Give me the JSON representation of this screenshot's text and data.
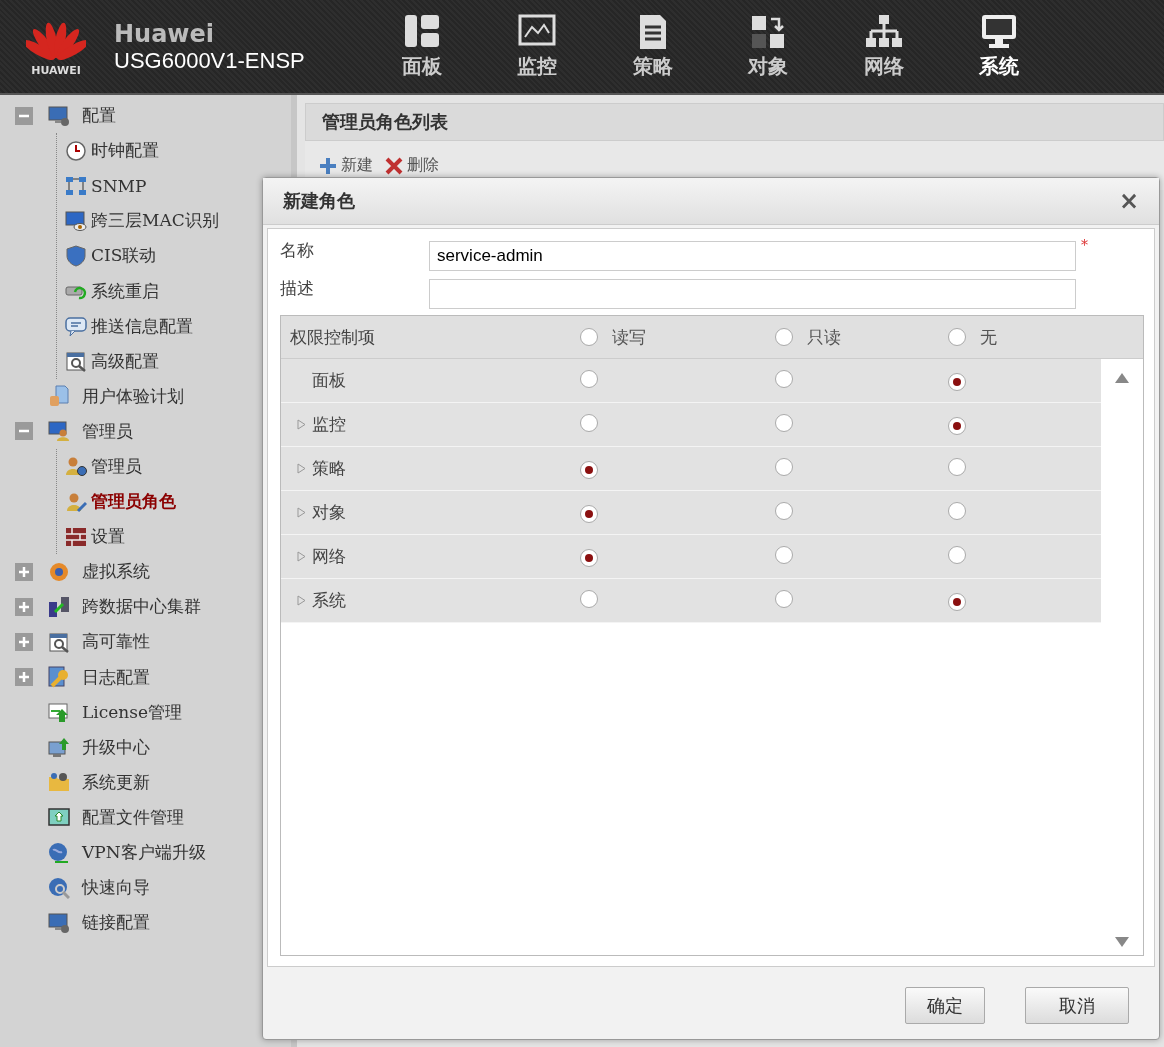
{
  "header": {
    "brand": "Huawei",
    "logo_text": "HUAWEI",
    "model": "USG6000V1-ENSP",
    "nav": [
      {
        "label": "面板",
        "selected": false
      },
      {
        "label": "监控",
        "selected": false
      },
      {
        "label": "策略",
        "selected": false
      },
      {
        "label": "对象",
        "selected": false
      },
      {
        "label": "网络",
        "selected": false
      },
      {
        "label": "系统",
        "selected": true
      }
    ]
  },
  "sidebar": {
    "items": [
      {
        "label": "配置",
        "expanded": true,
        "selected": false,
        "children": [
          {
            "label": "时钟配置",
            "selected": false
          },
          {
            "label": "SNMP",
            "selected": false
          },
          {
            "label": "跨三层MAC识别",
            "selected": false
          },
          {
            "label": "CIS联动",
            "selected": false
          },
          {
            "label": "系统重启",
            "selected": false
          },
          {
            "label": "推送信息配置",
            "selected": false
          },
          {
            "label": "高级配置",
            "selected": false
          }
        ]
      },
      {
        "label": "用户体验计划",
        "selected": false
      },
      {
        "label": "管理员",
        "expanded": true,
        "selected": false,
        "children": [
          {
            "label": "管理员",
            "selected": false
          },
          {
            "label": "管理员角色",
            "selected": true
          },
          {
            "label": "设置",
            "selected": false
          }
        ]
      },
      {
        "label": "虚拟系统",
        "expanded": false,
        "selected": false
      },
      {
        "label": "跨数据中心集群",
        "expanded": false,
        "selected": false
      },
      {
        "label": "高可靠性",
        "expanded": false,
        "selected": false
      },
      {
        "label": "日志配置",
        "expanded": false,
        "selected": false
      },
      {
        "label": "License管理",
        "selected": false
      },
      {
        "label": "升级中心",
        "selected": false
      },
      {
        "label": "系统更新",
        "selected": false
      },
      {
        "label": "配置文件管理",
        "selected": false
      },
      {
        "label": "VPN客户端升级",
        "selected": false
      },
      {
        "label": "快速向导",
        "selected": false
      },
      {
        "label": "链接配置",
        "selected": false
      }
    ]
  },
  "panel": {
    "title": "管理员角色列表",
    "toolbar": [
      "新建",
      "删除"
    ]
  },
  "dialog": {
    "title": "新建角色",
    "close": "×",
    "fields": [
      {
        "label": "名称",
        "value": "service-admin",
        "required_mark": "*"
      },
      {
        "label": "描述"
      }
    ],
    "permissions": {
      "heading": "权限控制项",
      "columns": [
        {
          "label": "读写",
          "selected": false
        },
        {
          "label": "只读",
          "selected": false
        },
        {
          "label": "无",
          "selected": false
        }
      ],
      "rows": [
        {
          "label": "面板",
          "expandable": false,
          "options": [
            {
              "selected": false
            },
            {
              "selected": false
            },
            {
              "selected": true
            }
          ]
        },
        {
          "label": "监控",
          "expandable": true,
          "options": [
            {
              "selected": false
            },
            {
              "selected": false
            },
            {
              "selected": true
            }
          ]
        },
        {
          "label": "策略",
          "expandable": true,
          "options": [
            {
              "selected": true
            },
            {
              "selected": false
            },
            {
              "selected": false
            }
          ]
        },
        {
          "label": "对象",
          "expandable": true,
          "options": [
            {
              "selected": true
            },
            {
              "selected": false
            },
            {
              "selected": false
            }
          ]
        },
        {
          "label": "网络",
          "expandable": true,
          "options": [
            {
              "selected": true
            },
            {
              "selected": false
            },
            {
              "selected": false
            }
          ]
        },
        {
          "label": "系统",
          "expandable": true,
          "options": [
            {
              "selected": false
            },
            {
              "selected": false
            },
            {
              "selected": true
            }
          ]
        }
      ]
    },
    "buttons": [
      "确定",
      "取消"
    ]
  }
}
